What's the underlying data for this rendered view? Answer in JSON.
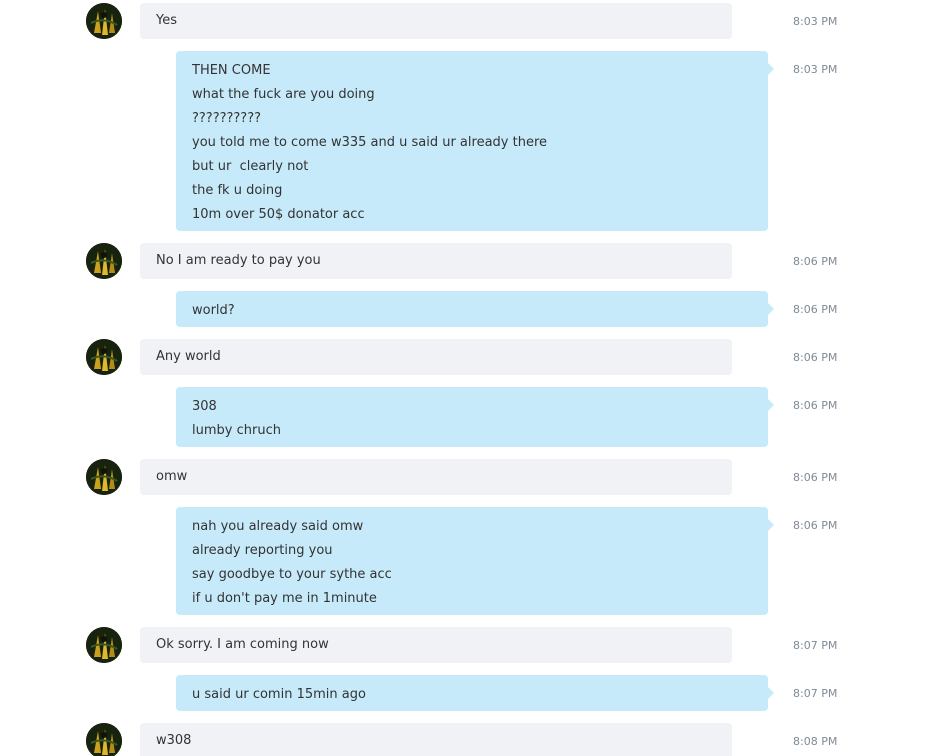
{
  "messages": [
    {
      "direction": "in",
      "time": "8:03 PM",
      "lines": [
        "Yes"
      ]
    },
    {
      "direction": "out",
      "time": "8:03 PM",
      "lines": [
        "THEN COME",
        "what the fuck are you doing",
        "??????????",
        "you told me to come w335 and u said ur already there",
        "but ur  clearly not",
        "the fk u doing",
        "10m over 50$ donator acc"
      ]
    },
    {
      "direction": "in",
      "time": "8:06 PM",
      "lines": [
        "No I am ready to pay you"
      ]
    },
    {
      "direction": "out",
      "time": "8:06 PM",
      "lines": [
        "world?"
      ]
    },
    {
      "direction": "in",
      "time": "8:06 PM",
      "lines": [
        "Any world"
      ]
    },
    {
      "direction": "out",
      "time": "8:06 PM",
      "lines": [
        "308",
        "lumby chruch"
      ]
    },
    {
      "direction": "in",
      "time": "8:06 PM",
      "lines": [
        "omw"
      ]
    },
    {
      "direction": "out",
      "time": "8:06 PM",
      "lines": [
        "nah you already said omw",
        "already reporting you",
        "say goodbye to your sythe acc",
        "if u don't pay me in 1minute"
      ]
    },
    {
      "direction": "in",
      "time": "8:07 PM",
      "lines": [
        "Ok sorry. I am coming now"
      ]
    },
    {
      "direction": "out",
      "time": "8:07 PM",
      "lines": [
        "u said ur comin 15min ago"
      ]
    },
    {
      "direction": "in",
      "time": "8:08 PM",
      "lines": [
        "w308"
      ]
    }
  ],
  "colors": {
    "incoming_bubble": "#f1f2f6",
    "outgoing_bubble": "#c7eafa",
    "timestamp": "#7f8a95"
  },
  "icons": {
    "avatar": "contact-avatar-icon"
  }
}
